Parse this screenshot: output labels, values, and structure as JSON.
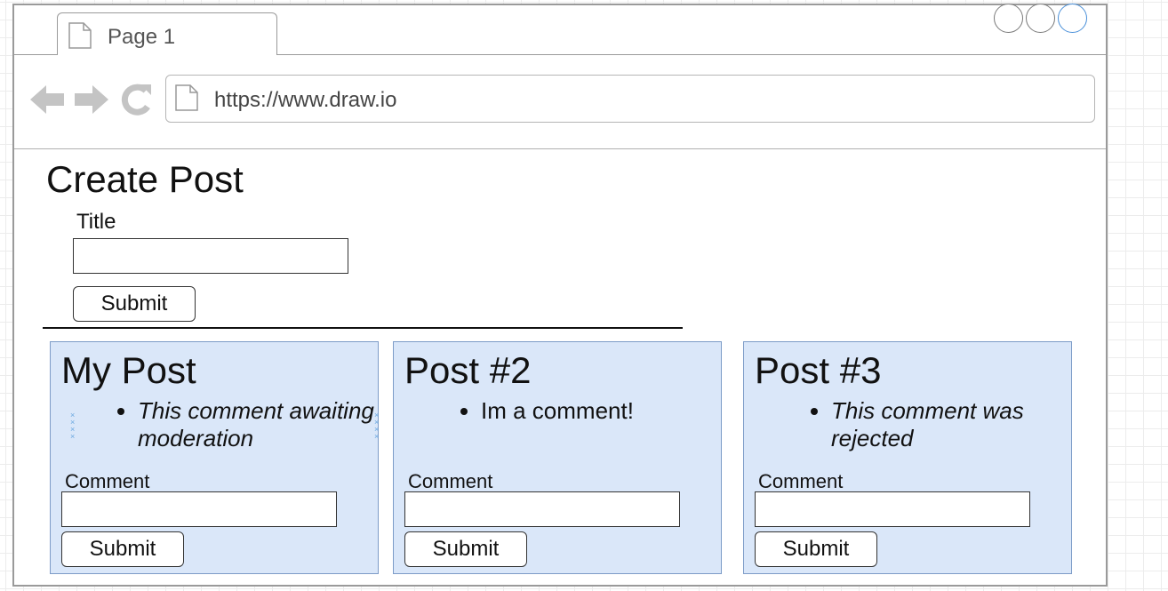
{
  "browser": {
    "tab_label": "Page 1",
    "url": "https://www.draw.io"
  },
  "create_post": {
    "heading": "Create Post",
    "title_label": "Title",
    "title_value": "",
    "submit_label": "Submit"
  },
  "posts": [
    {
      "title": "My Post",
      "comments": [
        "This comment awaiting moderation"
      ],
      "comment_label": "Comment",
      "comment_value": "",
      "submit_label": "Submit"
    },
    {
      "title": "Post #2",
      "comments": [
        "Im a comment!"
      ],
      "comment_label": "Comment",
      "comment_value": "",
      "submit_label": "Submit"
    },
    {
      "title": "Post #3",
      "comments": [
        "This comment was rejected"
      ],
      "comment_label": "Comment",
      "comment_value": "",
      "submit_label": "Submit"
    }
  ],
  "colors": {
    "card_fill": "#dae7f9",
    "card_border": "#7d9cc8",
    "maximize_accent": "#4a90d9"
  },
  "icons": [
    "page-icon",
    "back-arrow-icon",
    "forward-arrow-icon",
    "reload-icon"
  ]
}
